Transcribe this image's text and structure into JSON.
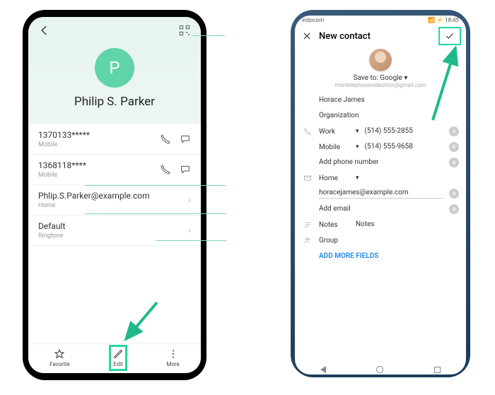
{
  "left": {
    "contact_name": "Philip S. Parker",
    "avatar_letter": "P",
    "phones": [
      {
        "number": "1370133*****",
        "type": "Mobile"
      },
      {
        "number": "1368118****",
        "type": "Mobile"
      }
    ],
    "email": {
      "address": "Phlip.S.Parker@example.com",
      "type": "Home"
    },
    "ringtone": {
      "value": "Default",
      "label": "Ringtone"
    },
    "bottom": {
      "favorite": "Favorite",
      "edit": "Edit",
      "more": "More"
    }
  },
  "right": {
    "status": {
      "carrier": "indocom",
      "time": "18:45"
    },
    "title": "New contact",
    "save_to_label": "Save to:",
    "save_to_value": "Google",
    "account_email": "montelephonevideotron@gmail.com",
    "name": "Horace James",
    "org_placeholder": "Organization",
    "phones": [
      {
        "type": "Work",
        "number": "(514) 555-2855"
      },
      {
        "type": "Mobile",
        "number": "(514) 555-9658"
      }
    ],
    "add_phone": "Add phone number",
    "email_type": "Home",
    "email_value": "horacejames@example.com",
    "add_email": "Add email",
    "notes_label": "Notes",
    "notes_placeholder": "Notes",
    "group_label": "Group",
    "add_more": "ADD MORE FIELDS"
  }
}
